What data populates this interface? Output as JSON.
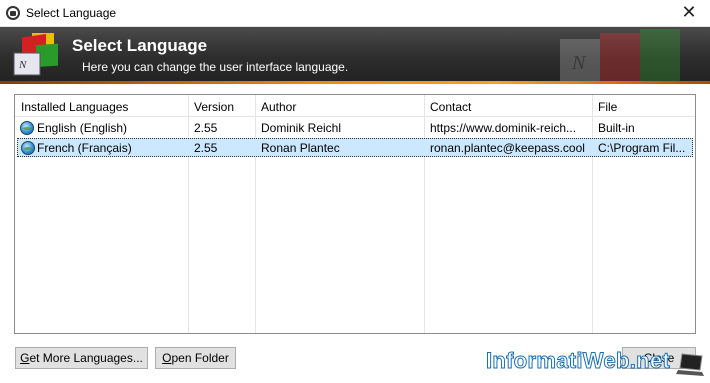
{
  "window": {
    "title": "Select Language",
    "close_glyph": "✕"
  },
  "banner": {
    "heading": "Select Language",
    "subheading": "Here you can change the user interface language."
  },
  "table": {
    "columns": [
      "Installed Languages",
      "Version",
      "Author",
      "Contact",
      "File"
    ],
    "rows": [
      {
        "language": "English (English)",
        "version": "2.55",
        "author": "Dominik Reichl",
        "contact": "https://www.dominik-reich...",
        "file": "Built-in",
        "selected": false
      },
      {
        "language": "French (Français)",
        "version": "2.55",
        "author": "Ronan Plantec",
        "contact": "ronan.plantec@keepass.cool",
        "file": "C:\\Program Fil...",
        "selected": true
      }
    ]
  },
  "buttons": {
    "get_more_prefix": "G",
    "get_more_rest": "et More Languages...",
    "open_folder_prefix": "O",
    "open_folder_rest": "pen Folder",
    "close": "Close"
  },
  "watermark": {
    "text": "InformatiWeb.net"
  },
  "colors": {
    "selection": "#cce8ff",
    "banner_accent": "#f08a10"
  }
}
